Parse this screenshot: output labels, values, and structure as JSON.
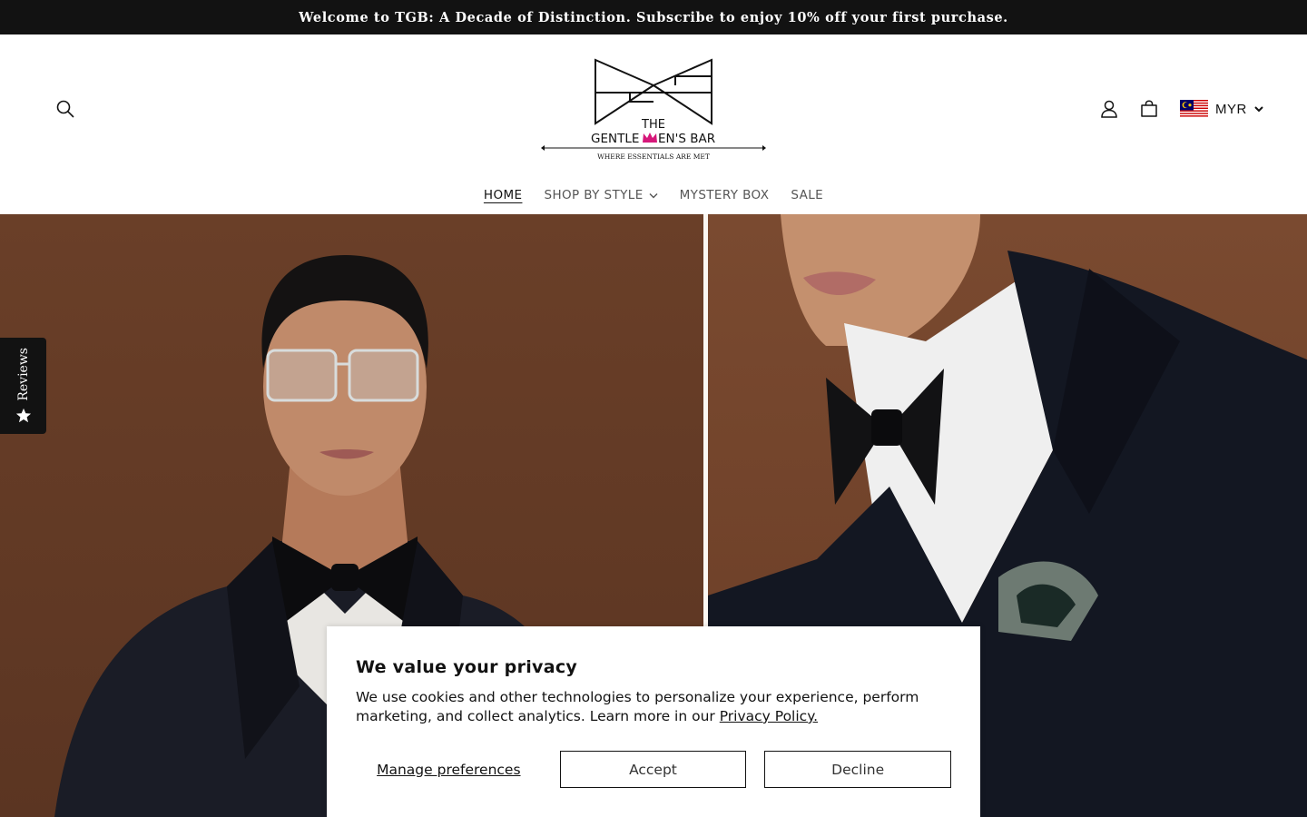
{
  "announcement": {
    "text": "Welcome to TGB: A Decade of Distinction. Subscribe to enjoy 10% off your first purchase."
  },
  "header": {
    "logo": {
      "line1": "THE",
      "line2_left": "GENTLE",
      "line2_right": "EN'S BAR",
      "tagline": "WHERE ESSENTIALS ARE MET",
      "accent_color": "#d6187a"
    },
    "currency": {
      "code": "MYR",
      "flag": "malaysia-flag"
    }
  },
  "nav": {
    "items": [
      {
        "label": "HOME"
      },
      {
        "label": "SHOP BY STYLE"
      },
      {
        "label": "MYSTERY BOX"
      },
      {
        "label": "SALE"
      }
    ]
  },
  "reviews_tab": {
    "label": "Reviews"
  },
  "cookie_banner": {
    "title": "We value your privacy",
    "body": "We use cookies and other technologies to personalize your experience, perform marketing, and collect analytics. Learn more in our ",
    "policy_link": "Privacy Policy.",
    "manage_label": "Manage preferences",
    "accept_label": "Accept",
    "decline_label": "Decline"
  },
  "colors": {
    "announcement_bg": "#121212",
    "hero_bg": "#6a3f28",
    "text": "#121212"
  }
}
